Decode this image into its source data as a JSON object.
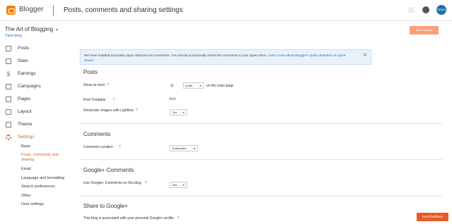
{
  "header": {
    "brand": "Blogger",
    "title": "Posts, comments and sharing settings",
    "avatar_text": "DEMO",
    "accent": "#f57d00"
  },
  "blog": {
    "name": "The Art of Blogging",
    "view_blog": "View blog"
  },
  "toolbar": {
    "save_label": "Save settings"
  },
  "sidebar": {
    "items": [
      {
        "label": "Posts",
        "icon": "posts-icon"
      },
      {
        "label": "Stats",
        "icon": "stats-icon"
      },
      {
        "label": "Earnings",
        "icon": "dollar-icon"
      },
      {
        "label": "Campaigns",
        "icon": "campaigns-icon"
      },
      {
        "label": "Pages",
        "icon": "pages-icon"
      },
      {
        "label": "Layout",
        "icon": "layout-icon"
      },
      {
        "label": "Theme",
        "icon": "theme-icon"
      },
      {
        "label": "Settings",
        "icon": "gear-icon"
      }
    ],
    "subitems": [
      "Basic",
      "Posts, comments and sharing",
      "Email",
      "Language and formatting",
      "Search preferences",
      "Other",
      "User settings"
    ]
  },
  "notice": {
    "text": "We have enabled automatic spam detection for comments. You should occasionally check the comments in your spam inbox. ",
    "link1": "Learn more about Blogger's spam detection",
    "mid": " or ",
    "link2": "report issues."
  },
  "posts": {
    "heading": "Posts",
    "show_at_most_label": "Show at most",
    "show_at_most_value": "11",
    "show_unit": "posts",
    "show_suffix": "on the main page",
    "template_label": "Post Template",
    "template_action": "Add",
    "lightbox_label": "Showcase images with Lightbox",
    "lightbox_value": "Yes"
  },
  "comments": {
    "heading": "Comments",
    "location_label": "Comment Location",
    "location_value": "Embedded"
  },
  "gplus": {
    "heading": "Google+ Comments",
    "use_label": "Use Google+ Comments on this blog",
    "use_value": "Yes"
  },
  "share": {
    "heading": "Share to Google+",
    "associated_label": "This blog is associated with your personal Google+ profile"
  },
  "feedback_label": "Send feedback",
  "help_glyph": "?",
  "caret_glyph": "▾",
  "close_glyph": "✕"
}
